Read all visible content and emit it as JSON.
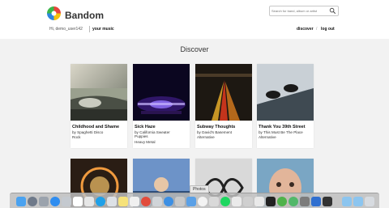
{
  "header": {
    "brand": "Bandom",
    "search": {
      "placeholder": "Search for band, album or artist"
    }
  },
  "user_bar": {
    "greeting": "Hi, demo_user142",
    "your_music": "your music",
    "nav": {
      "discover": "discover",
      "separator": "/",
      "logout": "log out"
    }
  },
  "main": {
    "title": "Discover",
    "albums": [
      {
        "title": "Childhood and Shame",
        "artist": "by Spaghetti Disco",
        "genre": "Rock"
      },
      {
        "title": "Sick Haze",
        "artist": "by California Sweater Puppies",
        "genre": "Heavy Metal"
      },
      {
        "title": "Subway Thoughts",
        "artist": "by David's Basement",
        "genre": "Alternative"
      },
      {
        "title": "Thank You 39th Street",
        "artist": "by This Must Be The Place",
        "genre": "Alternative"
      }
    ]
  },
  "tooltip": "Photos",
  "dock": {
    "icons": [
      "finder-icon",
      "launchpad-icon",
      "app-icon",
      "app-store-icon",
      "app-icon",
      "app-icon",
      "app-icon",
      "skype-icon",
      "app-icon",
      "notes-icon",
      "app-icon",
      "chrome-icon",
      "app-icon",
      "safari-icon",
      "app-icon",
      "mail-icon",
      "photos-icon",
      "app-icon",
      "spotify-icon",
      "app-icon",
      "app-icon",
      "app-icon",
      "terminal-icon",
      "app-icon",
      "app-icon",
      "app-icon",
      "app-icon",
      "app-icon",
      "folder-icon",
      "folder-icon",
      "trash-icon"
    ]
  },
  "colors": {
    "background": "#f2f2f2",
    "header": "#ffffff",
    "accent": "#111111"
  }
}
